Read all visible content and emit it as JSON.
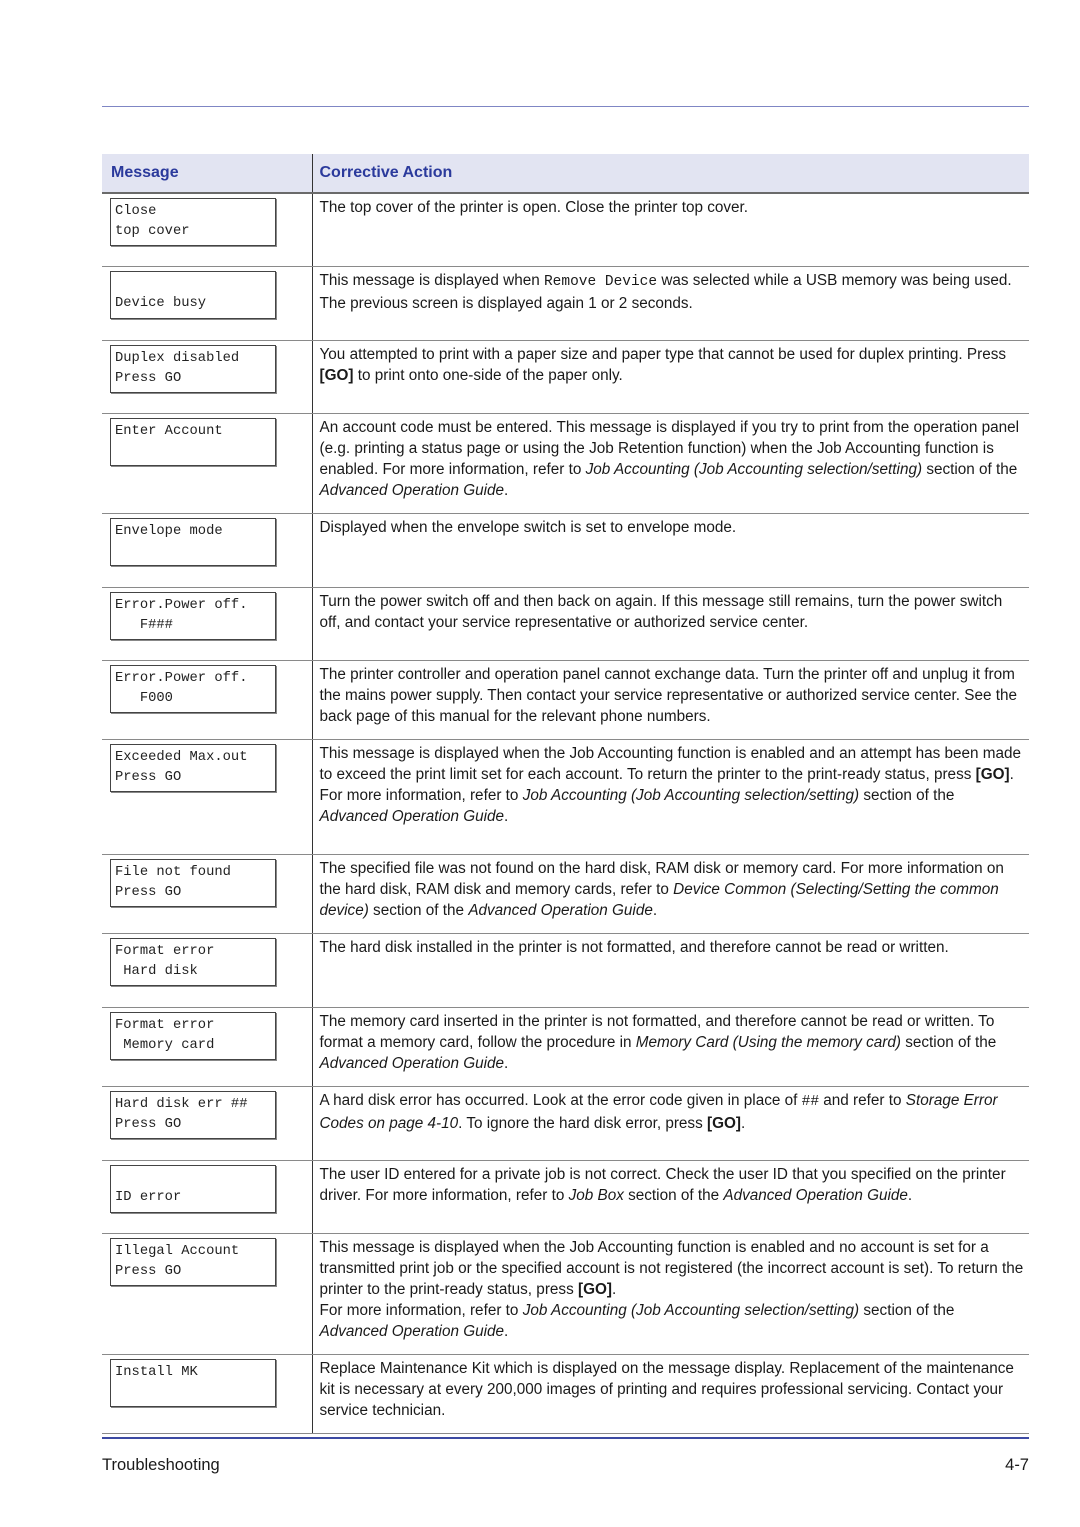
{
  "table": {
    "headers": {
      "message": "Message",
      "action": "Corrective Action"
    },
    "rows": [
      {
        "lcd": [
          "Close",
          "top cover"
        ],
        "lcd_align": "top",
        "action": [
          [
            {
              "t": "The top cover of the printer is open. Close the printer top cover."
            }
          ]
        ]
      },
      {
        "lcd": [
          "Device busy"
        ],
        "lcd_align": "bottom",
        "action": [
          [
            {
              "t": "This message is displayed when "
            },
            {
              "t": "Remove Device",
              "s": "code"
            },
            {
              "t": " was selected while a USB memory was being used."
            }
          ],
          [
            {
              "t": "The previous screen is displayed again 1 or 2 seconds."
            }
          ]
        ]
      },
      {
        "lcd": [
          "Duplex disabled",
          "Press GO"
        ],
        "lcd_align": "top",
        "action": [
          [
            {
              "t": "You attempted to print with a paper size and paper type that cannot be used for duplex printing. Press "
            },
            {
              "t": "[GO]",
              "s": "b"
            },
            {
              "t": " to print onto one-side of the paper only."
            }
          ]
        ]
      },
      {
        "lcd": [
          "Enter Account"
        ],
        "lcd_align": "top",
        "action": [
          [
            {
              "t": "An account code must be entered. This message is displayed if you try to print from the operation panel (e.g. printing a status page or using the Job Retention function) when the Job Accounting function is enabled. For more information, refer to "
            },
            {
              "t": "Job Accounting (Job Accounting selection/setting)",
              "s": "i"
            },
            {
              "t": " section of the "
            },
            {
              "t": "Advanced Operation Guide",
              "s": "i"
            },
            {
              "t": "."
            }
          ]
        ]
      },
      {
        "lcd": [
          "Envelope mode"
        ],
        "lcd_align": "top",
        "action": [
          [
            {
              "t": "Displayed when the envelope switch is set to envelope mode."
            }
          ]
        ]
      },
      {
        "lcd": [
          "Error.Power off.",
          "   F###"
        ],
        "lcd_align": "top",
        "action": [
          [
            {
              "t": "Turn the power switch off and then back on again. If this message still remains, turn the power switch off, and contact your service representative or authorized service center."
            }
          ]
        ]
      },
      {
        "lcd": [
          "Error.Power off.",
          "   F000"
        ],
        "lcd_align": "top",
        "action": [
          [
            {
              "t": "The printer controller and operation panel cannot exchange data. Turn the printer off and unplug it from the mains power supply. Then contact your service representative or authorized service center. See the back page of this manual for the relevant phone numbers."
            }
          ]
        ]
      },
      {
        "lcd": [
          "Exceeded Max.out",
          "Press GO"
        ],
        "lcd_align": "top",
        "action": [
          [
            {
              "t": "This message is displayed when the Job Accounting function is enabled and an attempt has been made to exceed the print limit set for each account. To return the printer to the print-ready status, press "
            },
            {
              "t": "[GO]",
              "s": "b"
            },
            {
              "t": "."
            }
          ],
          [
            {
              "t": "For more information, refer to "
            },
            {
              "t": "Job Accounting (Job Accounting selection/setting)",
              "s": "i"
            },
            {
              "t": " section of the "
            },
            {
              "t": "Advanced Operation Guide",
              "s": "i"
            },
            {
              "t": "."
            }
          ]
        ]
      },
      {
        "lcd": [
          "File not found",
          "Press GO"
        ],
        "lcd_align": "top",
        "action": [
          [
            {
              "t": "The specified file was not found on the hard disk, RAM disk or memory card. For more information on the hard disk, RAM disk and memory cards, refer to "
            },
            {
              "t": "Device Common (Selecting/Setting the common device)",
              "s": "i"
            },
            {
              "t": " section of the "
            },
            {
              "t": "Advanced Operation Guide",
              "s": "i"
            },
            {
              "t": "."
            }
          ]
        ]
      },
      {
        "lcd": [
          "Format error",
          " Hard disk"
        ],
        "lcd_align": "top",
        "action": [
          [
            {
              "t": "The hard disk installed in the printer is not formatted, and therefore cannot be read or written."
            }
          ]
        ]
      },
      {
        "lcd": [
          "Format error",
          " Memory card"
        ],
        "lcd_align": "top",
        "action": [
          [
            {
              "t": "The memory card inserted in the printer is not formatted, and therefore cannot be read or written. To format a memory card, follow the procedure in "
            },
            {
              "t": "Memory Card (Using the memory card)",
              "s": "i"
            },
            {
              "t": " section of the "
            },
            {
              "t": "Advanced Operation Guide",
              "s": "i"
            },
            {
              "t": "."
            }
          ]
        ]
      },
      {
        "lcd": [
          "Hard disk err ##",
          "Press GO"
        ],
        "lcd_align": "top",
        "action": [
          [
            {
              "t": "A hard disk error has occurred. Look at the error code given in place of "
            },
            {
              "t": "##",
              "s": "code"
            },
            {
              "t": " and refer to "
            },
            {
              "t": "Storage Error Codes on page 4-10",
              "s": "i"
            },
            {
              "t": ". To ignore the hard disk error, press "
            },
            {
              "t": "[GO]",
              "s": "b"
            },
            {
              "t": "."
            }
          ]
        ]
      },
      {
        "lcd": [
          "ID error"
        ],
        "lcd_align": "bottom",
        "action": [
          [
            {
              "t": "The user ID entered for a private job is not correct. Check the user ID that you specified on the printer driver. For more information, refer to "
            },
            {
              "t": "Job Box",
              "s": "i"
            },
            {
              "t": " section of the "
            },
            {
              "t": "Advanced Operation Guide",
              "s": "i"
            },
            {
              "t": "."
            }
          ]
        ]
      },
      {
        "lcd": [
          "Illegal Account",
          "Press GO"
        ],
        "lcd_align": "top",
        "action": [
          [
            {
              "t": "This message is displayed when the Job Accounting function is enabled and no account is set for a transmitted print job or the specified account is not registered (the incorrect account is set). To return the printer to the print-ready status, press "
            },
            {
              "t": "[GO]",
              "s": "b"
            },
            {
              "t": "."
            }
          ],
          [
            {
              "t": "For more information, refer to "
            },
            {
              "t": "Job Accounting (Job Accounting selection/setting)",
              "s": "i"
            },
            {
              "t": " section of the "
            },
            {
              "t": "Advanced Operation Guide",
              "s": "i"
            },
            {
              "t": "."
            }
          ]
        ]
      },
      {
        "lcd": [
          "Install MK"
        ],
        "lcd_align": "top",
        "action": [
          [
            {
              "t": "Replace Maintenance Kit which is displayed on the message display. Replacement of the maintenance kit is necessary at every 200,000 images of printing and requires professional servicing. Contact your service technician."
            }
          ]
        ]
      }
    ]
  },
  "footer": {
    "section": "Troubleshooting",
    "page": "4-7"
  },
  "colors": {
    "header_bg": "#e2e4f2",
    "header_text": "#2b3a9c",
    "rule": "#3d4aa3"
  }
}
